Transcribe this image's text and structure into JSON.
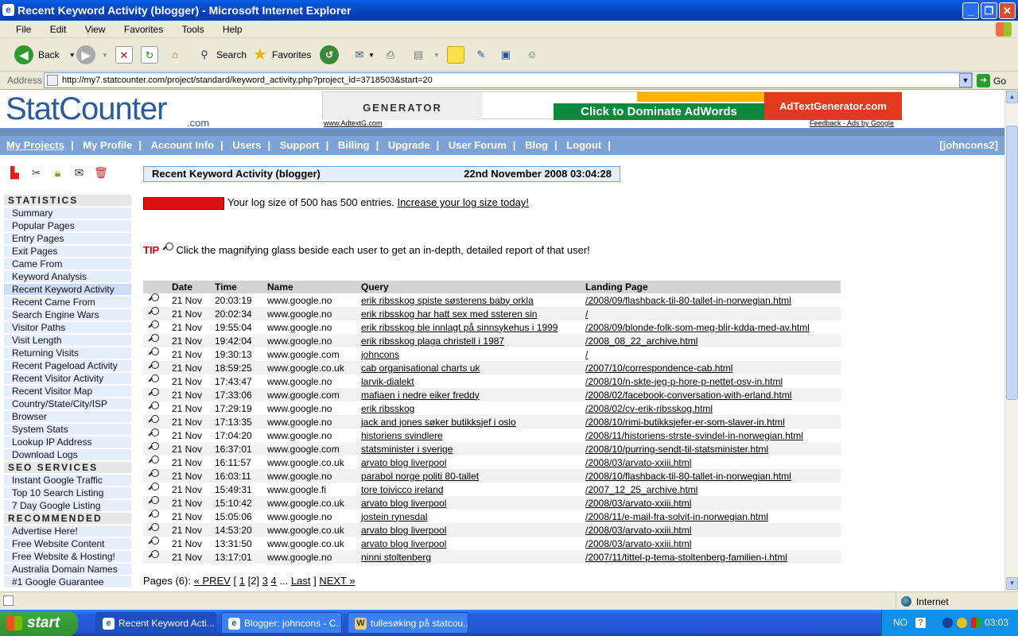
{
  "window": {
    "title": "Recent Keyword Activity (blogger) - Microsoft Internet Explorer",
    "menu": [
      "File",
      "Edit",
      "View",
      "Favorites",
      "Tools",
      "Help"
    ]
  },
  "toolbar": {
    "back": "Back",
    "search": "Search",
    "favorites": "Favorites"
  },
  "address": {
    "label": "Address",
    "url": "http://my7.statcounter.com/project/standard/keyword_activity.php?project_id=3718503&start=20",
    "go": "Go"
  },
  "header": {
    "logo_main": "StatCounter",
    "logo_suffix": ".com",
    "ad_left": "GENERATOR",
    "ad_middle": "Click to Dominate AdWords",
    "ad_right": "AdTextGenerator.com",
    "ad_url": "www.AdtextG.com",
    "ad_feedback": "Feedback - Ads by Google"
  },
  "nav": {
    "items": [
      "My Projects",
      "My Profile",
      "Account Info",
      "Users",
      "Support",
      "Billing",
      "Upgrade",
      "User Forum",
      "Blog",
      "Logout"
    ],
    "user": "[johncons2]"
  },
  "sidebar": {
    "statistics_title": "STATISTICS",
    "statistics": [
      "Summary",
      "Popular Pages",
      "Entry Pages",
      "Exit Pages",
      "Came From",
      "Keyword Analysis",
      "Recent Keyword Activity",
      "Recent Came From",
      "Search Engine Wars",
      "Visitor Paths",
      "Visit Length",
      "Returning Visits",
      "Recent Pageload Activity",
      "Recent Visitor Activity",
      "Recent Visitor Map",
      "Country/State/City/ISP",
      "Browser",
      "System Stats",
      "Lookup IP Address",
      "Download Logs"
    ],
    "seo_title": "SEO SERVICES",
    "seo": [
      "Instant Google Traffic",
      "Top 10 Search Listing",
      "7 Day Google Listing"
    ],
    "rec_title": "RECOMMENDED",
    "recommended": [
      "Advertise Here!",
      "Free Website Content",
      "Free Website & Hosting!",
      "Australia Domain Names",
      "#1 Google Guarantee"
    ]
  },
  "content": {
    "title": "Recent Keyword Activity (blogger)",
    "date": "22nd November 2008 03:04:28",
    "log_text": "Your log size of 500 has 500 entries.",
    "log_link": "Increase your log size today!",
    "tip_label": "TIP",
    "tip_text": "Click the magnifying glass beside each user to get an in-depth, detailed report of that user!",
    "columns": [
      "Date",
      "Time",
      "Name",
      "Query",
      "Landing Page"
    ],
    "rows": [
      {
        "date": "21 Nov",
        "time": "20:03:19",
        "name": "www.google.no",
        "query": "erik ribsskog spiste søsterens baby orkla",
        "page": "/2008/09/flashback-til-80-tallet-in-norwegian.html"
      },
      {
        "date": "21 Nov",
        "time": "20:02:34",
        "name": "www.google.no",
        "query": "erik ribsskog har hatt sex med ssteren sin",
        "page": "/"
      },
      {
        "date": "21 Nov",
        "time": "19:55:04",
        "name": "www.google.no",
        "query": "erik ribsskog ble innlagt på sinnsykehus i 1999",
        "page": "/2008/09/blonde-folk-som-meg-blir-kdda-med-av.html"
      },
      {
        "date": "21 Nov",
        "time": "19:42:04",
        "name": "www.google.no",
        "query": "erik ribsskog plaga christell i 1987",
        "page": "/2008_08_22_archive.html"
      },
      {
        "date": "21 Nov",
        "time": "19:30:13",
        "name": "www.google.com",
        "query": "johncons",
        "page": "/"
      },
      {
        "date": "21 Nov",
        "time": "18:59:25",
        "name": "www.google.co.uk",
        "query": "cab organisational charts uk",
        "page": "/2007/10/correspondence-cab.html"
      },
      {
        "date": "21 Nov",
        "time": "17:43:47",
        "name": "www.google.no",
        "query": "larvik-dialekt",
        "page": "/2008/10/n-skte-jeg-p-hore-p-nettet-osv-in.html"
      },
      {
        "date": "21 Nov",
        "time": "17:33:06",
        "name": "www.google.com",
        "query": "mafiaen i nedre eiker freddy",
        "page": "/2008/02/facebook-conversation-with-erland.html"
      },
      {
        "date": "21 Nov",
        "time": "17:29:19",
        "name": "www.google.no",
        "query": "erik ribsskog",
        "page": "/2008/02/cv-erik-ribsskog.html"
      },
      {
        "date": "21 Nov",
        "time": "17:13:35",
        "name": "www.google.no",
        "query": "jack and jones søker butikksjef i oslo",
        "page": "/2008/10/rimi-butikksjefer-er-som-slaver-in.html"
      },
      {
        "date": "21 Nov",
        "time": "17:04:20",
        "name": "www.google.no",
        "query": "historiens svindlere",
        "page": "/2008/11/historiens-strste-svindel-in-norwegian.html"
      },
      {
        "date": "21 Nov",
        "time": "16:37:01",
        "name": "www.google.com",
        "query": "statsminister i sverige",
        "page": "/2008/10/purring-sendt-til-statsminister.html"
      },
      {
        "date": "21 Nov",
        "time": "16:11:57",
        "name": "www.google.co.uk",
        "query": "arvato blog liverpool",
        "page": "/2008/03/arvato-xxiii.html"
      },
      {
        "date": "21 Nov",
        "time": "16:03:11",
        "name": "www.google.no",
        "query": "parabol norge politi 80-tallet",
        "page": "/2008/10/flashback-til-80-tallet-in-norwegian.html"
      },
      {
        "date": "21 Nov",
        "time": "15:49:31",
        "name": "www.google.fi",
        "query": "tore toivicco ireland",
        "page": "/2007_12_25_archive.html"
      },
      {
        "date": "21 Nov",
        "time": "15:10:42",
        "name": "www.google.co.uk",
        "query": "arvato blog liverpool",
        "page": "/2008/03/arvato-xxiii.html"
      },
      {
        "date": "21 Nov",
        "time": "15:05:06",
        "name": "www.google.no",
        "query": "jostein rynesdal",
        "page": "/2008/11/e-mail-fra-solvit-in-norwegian.html"
      },
      {
        "date": "21 Nov",
        "time": "14:53:20",
        "name": "www.google.co.uk",
        "query": "arvato blog liverpool",
        "page": "/2008/03/arvato-xxiii.html"
      },
      {
        "date": "21 Nov",
        "time": "13:31:50",
        "name": "www.google.co.uk",
        "query": "arvato blog liverpool",
        "page": "/2008/03/arvato-xxiii.html"
      },
      {
        "date": "21 Nov",
        "time": "13:17:01",
        "name": "www.google.no",
        "query": "ninni stoltenberg",
        "page": "/2007/11/tittel-p-tema-stoltenberg-familien-i.html"
      }
    ],
    "pages": {
      "label": "Pages (6):",
      "prev": "« PREV",
      "open": "[",
      "p1": "1",
      "current": "[2]",
      "p3": "3",
      "p4": "4",
      "dots": "...",
      "last": "Last",
      "close": "]",
      "next": "NEXT »"
    }
  },
  "statusbar": {
    "zone": "Internet"
  },
  "taskbar": {
    "start": "start",
    "tasks": [
      "Recent Keyword Acti...",
      "Blogger: johncons - C...",
      "tullesøking på statcou..."
    ],
    "lang": "NO",
    "clock": "03:03"
  }
}
